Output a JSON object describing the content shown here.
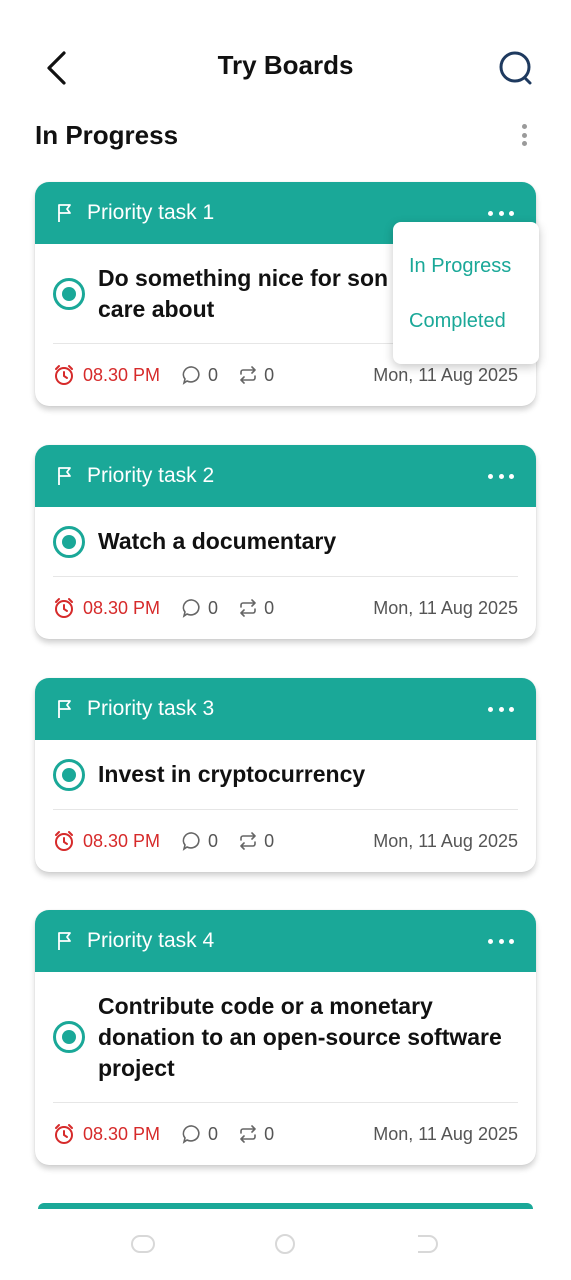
{
  "header": {
    "title": "Try Boards"
  },
  "section": {
    "title": "In Progress"
  },
  "status_menu": {
    "items": [
      "In Progress",
      "Completed"
    ]
  },
  "cards": [
    {
      "label": "Priority task 1",
      "task": "Do something nice for someone you care about",
      "task_visible_line1": "Do something nice for son",
      "task_visible_line2": "care about",
      "time": "08.30 PM",
      "comments": "0",
      "repeats": "0",
      "date": "Mon, 11 Aug 2025"
    },
    {
      "label": "Priority task 2",
      "task": "Watch a documentary",
      "time": "08.30 PM",
      "comments": "0",
      "repeats": "0",
      "date": "Mon, 11 Aug 2025"
    },
    {
      "label": "Priority task 3",
      "task": "Invest in cryptocurrency",
      "time": "08.30 PM",
      "comments": "0",
      "repeats": "0",
      "date": "Mon, 11 Aug 2025"
    },
    {
      "label": "Priority task 4",
      "task": "Contribute code or a monetary donation to an open-source software project",
      "time": "08.30 PM",
      "comments": "0",
      "repeats": "0",
      "date": "Mon, 11 Aug 2025"
    }
  ],
  "colors": {
    "accent": "#1aa898",
    "time": "#d62a2a"
  },
  "icons": [
    "back-arrow-icon",
    "search-icon",
    "more-vertical-icon",
    "flag-icon",
    "more-horizontal-icon",
    "radio-icon",
    "clock-icon",
    "comment-icon",
    "repeat-icon"
  ]
}
